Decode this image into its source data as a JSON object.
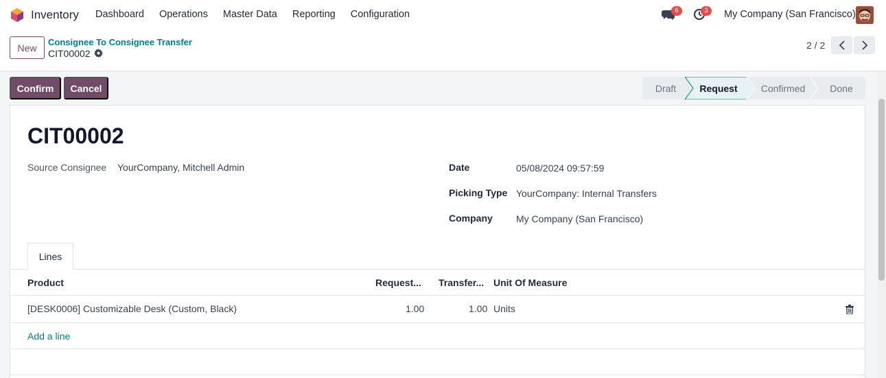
{
  "app": {
    "name": "Inventory"
  },
  "menu": [
    "Dashboard",
    "Operations",
    "Master Data",
    "Reporting",
    "Configuration"
  ],
  "nav": {
    "chat_count": "6",
    "activity_count": "3",
    "company": "My Company (San Francisco)"
  },
  "control": {
    "new_label": "New",
    "breadcrumb_parent": "Consignee To Consignee Transfer",
    "breadcrumb_current": "CIT00002",
    "pager": "2 / 2"
  },
  "actions": {
    "confirm_label": "Confirm",
    "cancel_label": "Cancel"
  },
  "status": {
    "stages": [
      "Draft",
      "Request",
      "Confirmed",
      "Done"
    ],
    "current": "Request"
  },
  "record": {
    "title": "CIT00002",
    "source_label": "Source Consignee",
    "source_value": "YourCompany, Mitchell Admin",
    "date_label": "Date",
    "date_value": "05/08/2024 09:57:59",
    "picking_label": "Picking Type",
    "picking_value": "YourCompany: Internal Transfers",
    "company_label": "Company",
    "company_value": "My Company (San Francisco)"
  },
  "tabs": {
    "lines": "Lines"
  },
  "table": {
    "headers": {
      "product": "Product",
      "request": "Request...",
      "transfer": "Transfer...",
      "uom": "Unit Of Measure"
    },
    "rows": [
      {
        "product": "[DESK0006] Customizable Desk (Custom, Black)",
        "request": "1.00",
        "transfer": "1.00",
        "uom": "Units"
      }
    ],
    "add_line": "Add a line"
  },
  "colors": {
    "brand": "#714b67",
    "link": "#017e84",
    "badge": "#e24d4d"
  }
}
